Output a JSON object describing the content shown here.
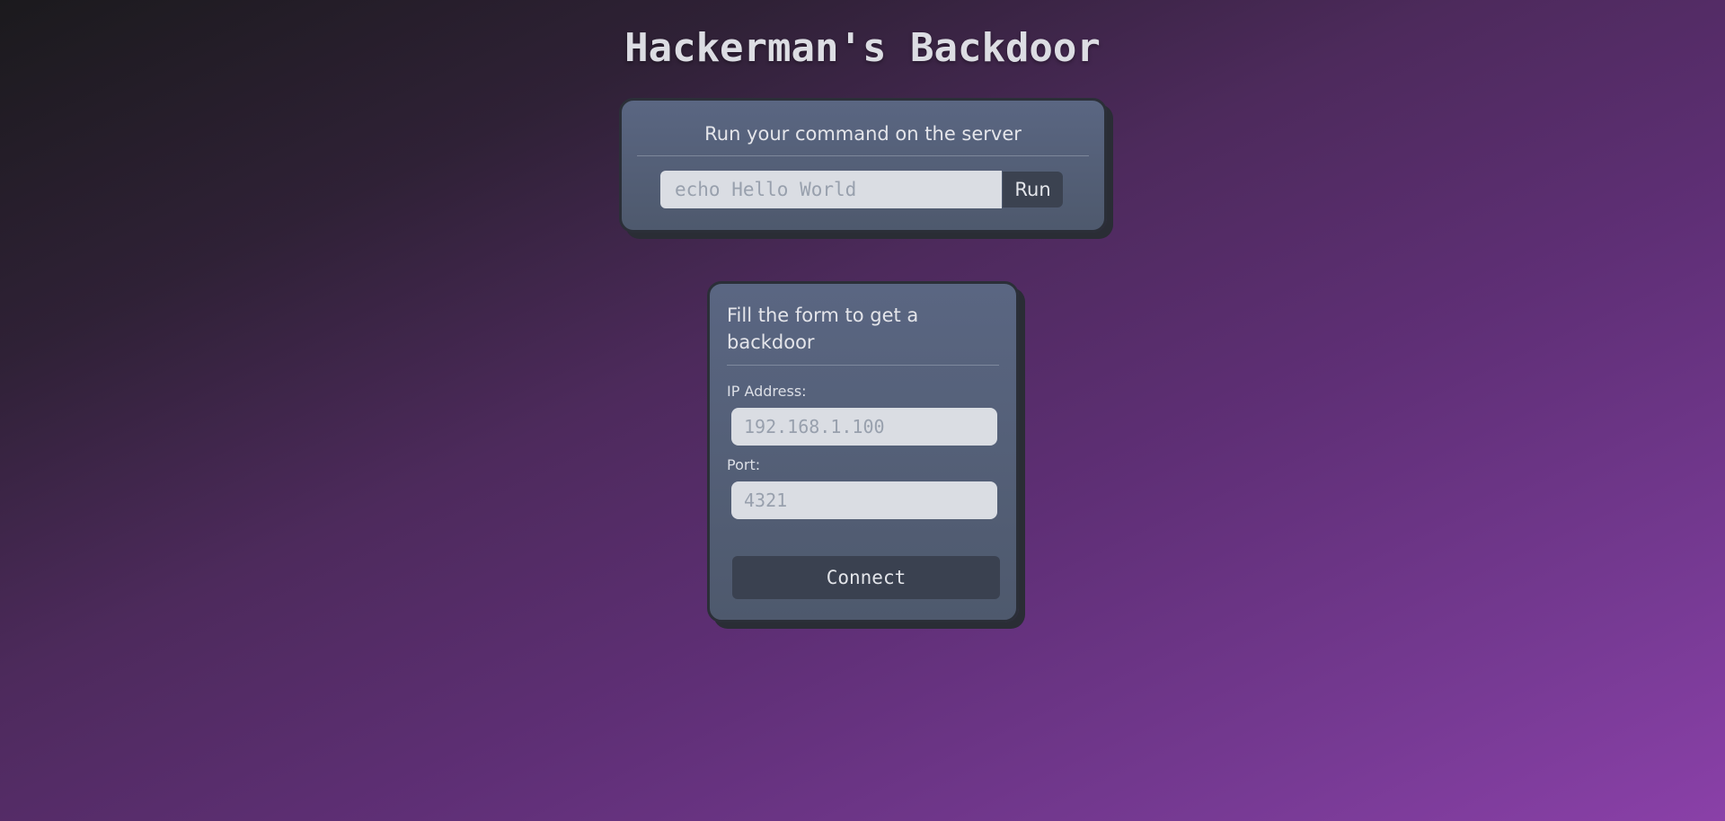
{
  "page": {
    "title": "Hackerman's Backdoor"
  },
  "command_card": {
    "heading": "Run your command on the server",
    "input_placeholder": "echo Hello World",
    "run_label": "Run"
  },
  "backdoor_card": {
    "heading": "Fill the form to get a backdoor",
    "ip_label": "IP Address:",
    "ip_placeholder": "192.168.1.100",
    "port_label": "Port:",
    "port_placeholder": "4321",
    "connect_label": "Connect"
  },
  "colors": {
    "card_background": "#556078",
    "card_border": "#2b2f38",
    "button_background": "#3a4150",
    "input_background": "#dadde3",
    "background_start": "#1b1a1d",
    "background_end": "#8a40a8"
  }
}
